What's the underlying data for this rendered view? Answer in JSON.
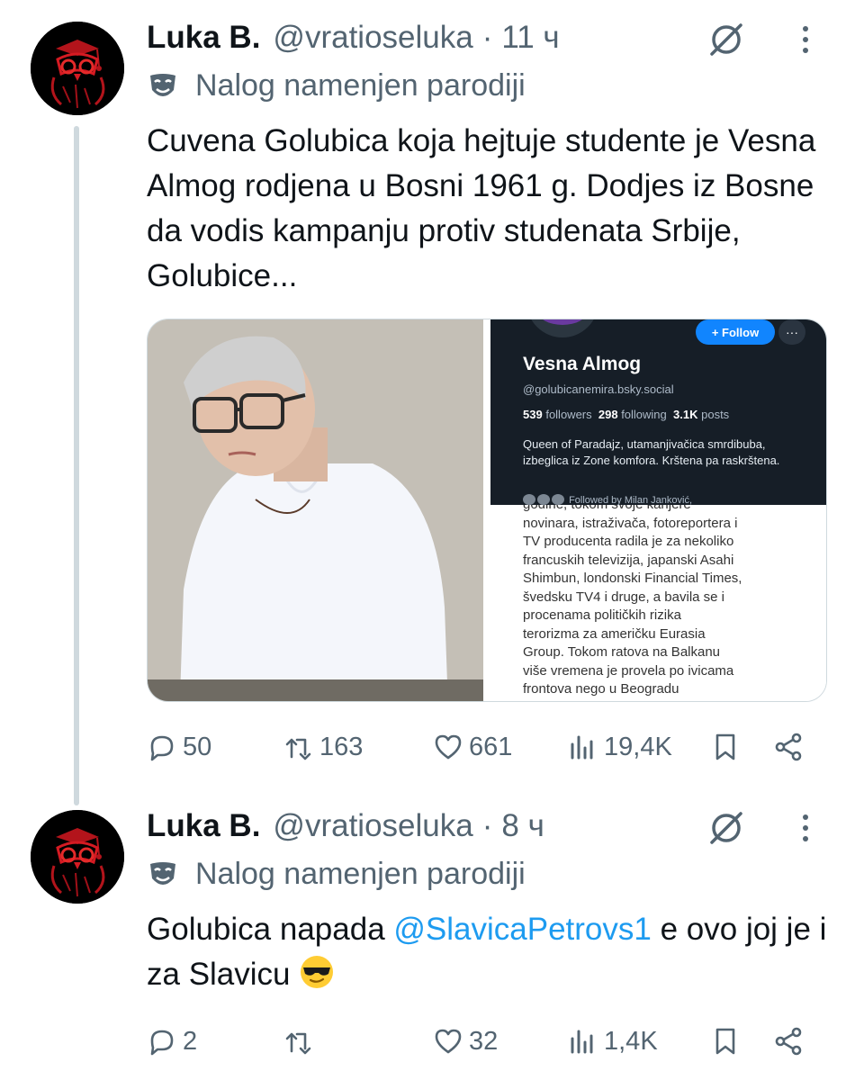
{
  "tweets": [
    {
      "name": "Luka B.",
      "handle": "@vratioseluka",
      "separator": "·",
      "time": "11 ч",
      "parody_label": "Nalog namenjen parodiji",
      "text": "Cuvena Golubica koja hejtuje studente je Vesna Almog rodjena u Bosni 1961 g. Dodjes iz Bosne da vodis kampanju protiv studenata Srbije, Golubice...",
      "replies": "50",
      "retweets": "163",
      "likes": "661",
      "views": "19,4K"
    },
    {
      "name": "Luka B.",
      "handle": "@vratioseluka",
      "separator": "·",
      "time": "8 ч",
      "parody_label": "Nalog namenjen parodiji",
      "text_before": "Golubica napada ",
      "mention": "@SlavicaPetrovs1",
      "text_after": " e ovo joj je i za Slavicu ",
      "emoji": "smiling-face-with-sunglasses",
      "replies": "2",
      "retweets": "",
      "likes": "32",
      "views": "1,4K"
    }
  ],
  "embedded_profile": {
    "follow_label": "+ Follow",
    "more_label": "···",
    "name": "Vesna Almog",
    "handle": "@golubicanemira.bsky.social",
    "followers_count": "539",
    "followers_label": "followers",
    "following_count": "298",
    "following_label": "following",
    "posts_count": "3.1K",
    "posts_label": "posts",
    "bio": "Queen of Paradajz, utamanjivačica smrdibuba, izbeglica iz Zone komfora. Krštena pa raskrštena.",
    "followed_by": "Followed by Milan Janković,"
  },
  "embedded_article": {
    "lines": [
      "godine, tokom svoje karijere",
      "novinara, istraživača, fotoreportera i",
      "TV producenta radila je za nekoliko",
      "francuskih televizija, japanski Asahi",
      "Shimbun, londonski Financial Times,",
      "švedsku TV4 i druge, a bavila se i",
      "procenama političkih rizika",
      "terorizma za američku Eurasia",
      "Group. Tokom ratova na Balkanu",
      "više vremena je provela po ivicama",
      "frontova nego u Beogradu"
    ]
  },
  "colors": {
    "text": "#0f1419",
    "muted": "#536471",
    "link": "#1d9bf0",
    "thread_line": "#cfd9de",
    "follow_button": "#1185fe",
    "profile_bg": "#161e27"
  },
  "icons": [
    "avatar-owl",
    "grok-icon",
    "more-icon",
    "mask-icon",
    "reply-icon",
    "retweet-icon",
    "like-icon",
    "views-icon",
    "bookmark-icon",
    "share-icon"
  ]
}
